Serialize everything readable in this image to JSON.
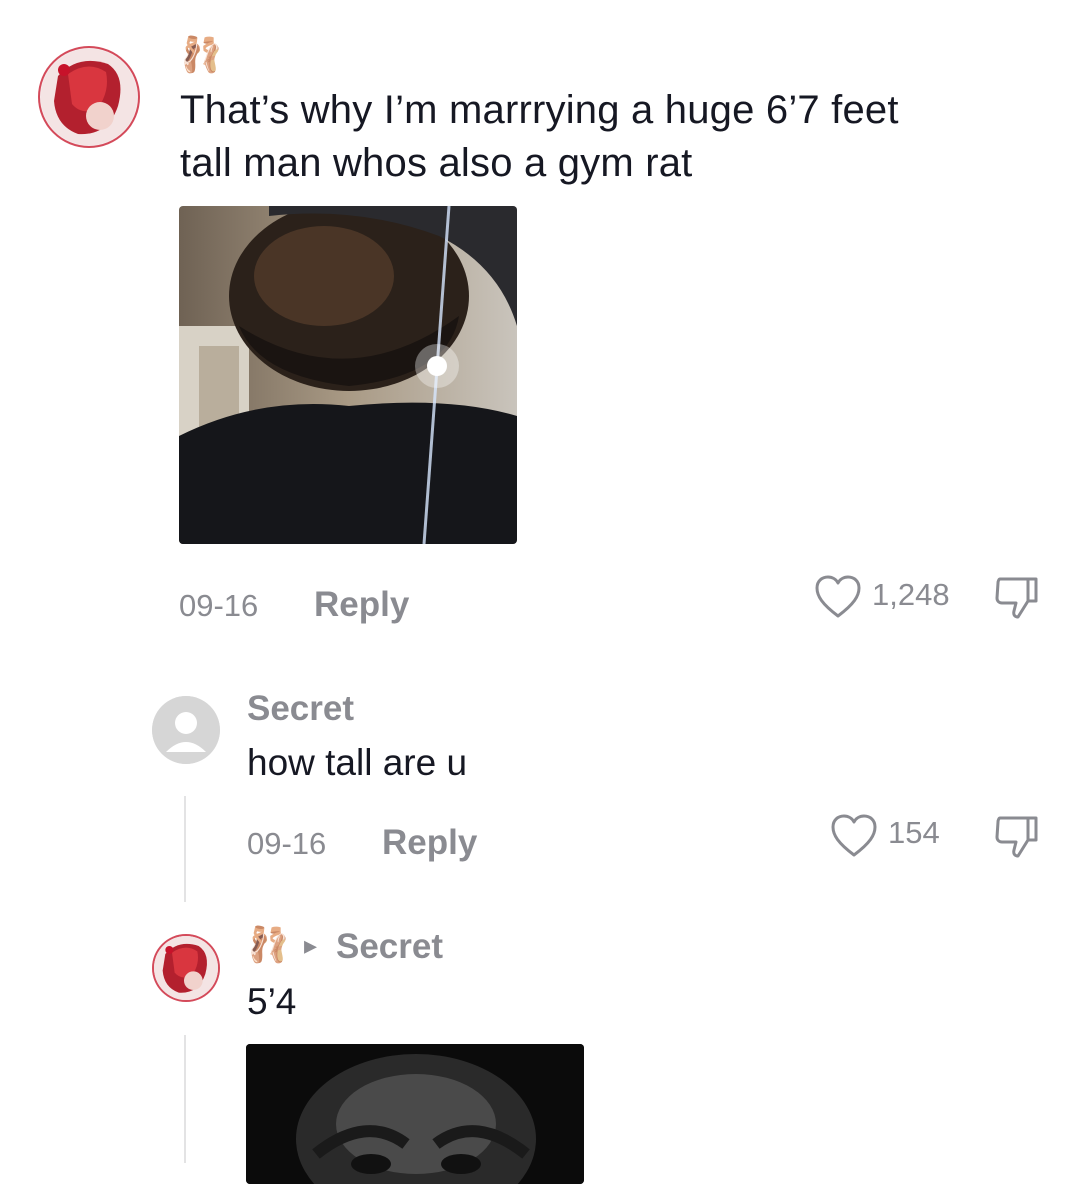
{
  "comments": [
    {
      "username_badge": "🩰",
      "text_line1": "That’s why I’m marrrying a huge 6’7 feet",
      "text_line2": "tall man whos also a gym rat",
      "date": "09-16",
      "reply_label": "Reply",
      "likes": "1,248",
      "has_image": true
    }
  ],
  "replies": [
    {
      "username": "Secret",
      "text": "how tall are u",
      "date": "09-16",
      "reply_label": "Reply",
      "likes": "154"
    },
    {
      "username_badge": "🩰",
      "reply_to_arrow": "▸",
      "reply_to": "Secret",
      "text": "5’4",
      "has_image": true
    }
  ],
  "colors": {
    "muted": "#8a8b91",
    "text": "#161823",
    "avatar_ring": "#d44a5a"
  },
  "icons": {
    "like": "heart-outline-icon",
    "dislike": "thumbs-down-outline-icon"
  }
}
